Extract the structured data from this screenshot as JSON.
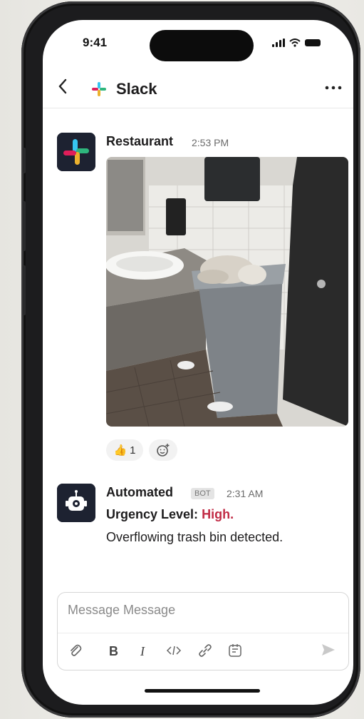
{
  "status": {
    "time": "9:41"
  },
  "header": {
    "back_icon": "chevron-left-icon",
    "title": "Slack",
    "more_icon": "ellipsis-icon"
  },
  "messages": [
    {
      "sender": "Restaurant",
      "time": "2:53 PM",
      "avatar": "slack-logo",
      "attachment": "photo of restroom with overflowing trash bin"
    },
    {
      "sender": "Automated",
      "badge": "BOT",
      "time": "2:31 AM",
      "urgency_label": "Urgency Level:",
      "urgency_value": "High",
      "urgency_suffix": ".",
      "text": "Overflowing trash bin detected."
    }
  ],
  "reactions": [
    {
      "emoji": "👍",
      "count": "1"
    }
  ],
  "composer": {
    "placeholder": "Message Message",
    "tools": [
      "attach-icon",
      "B",
      "I",
      "code-icon",
      "link-icon",
      "snippet-icon"
    ],
    "send_icon": "send-icon"
  },
  "colors": {
    "accent_red": "#c12b45",
    "avatar_bg": "#1d2231"
  }
}
